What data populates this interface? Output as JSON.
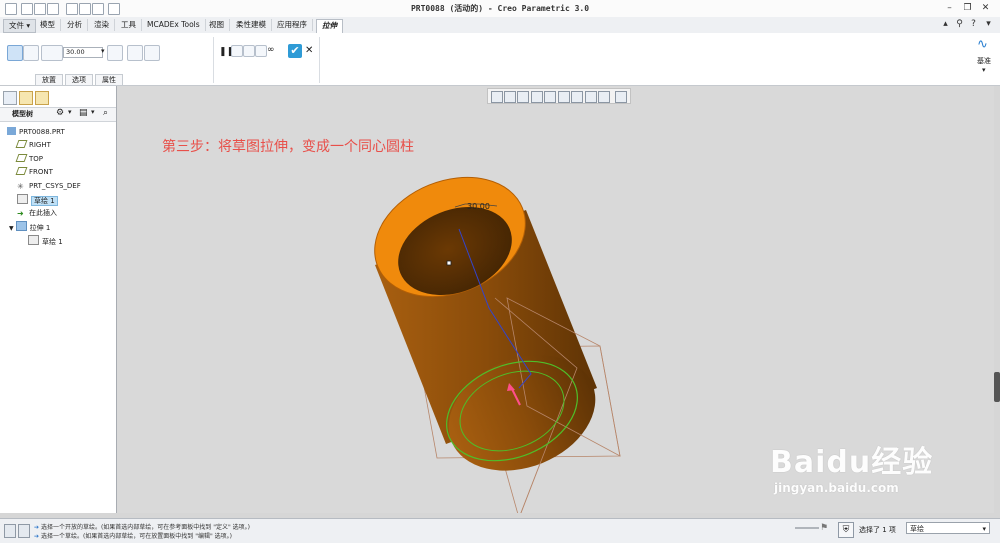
{
  "window": {
    "title": "PRT0088 (活动的) - Creo Parametric 3.0"
  },
  "menu_tabs": [
    {
      "label": "文件 ▾"
    },
    {
      "label": "模型"
    },
    {
      "label": "分析"
    },
    {
      "label": "渲染"
    },
    {
      "label": "工具"
    },
    {
      "label": "MCADEx Tools"
    },
    {
      "label": "视图"
    },
    {
      "label": "柔性建模"
    },
    {
      "label": "应用程序"
    },
    {
      "label": "拉伸"
    }
  ],
  "ribbon": {
    "depth_value": "30.00",
    "subtabs": [
      "放置",
      "选项",
      "属性"
    ],
    "datum_label": "基准"
  },
  "model_tree": {
    "header": "模型树",
    "items": [
      {
        "label": "PRT0088.PRT",
        "icon": "part-icon"
      },
      {
        "label": "RIGHT",
        "icon": "plane-icon"
      },
      {
        "label": "TOP",
        "icon": "plane-icon"
      },
      {
        "label": "FRONT",
        "icon": "plane-icon"
      },
      {
        "label": "PRT_CSYS_DEF",
        "icon": "csys-icon"
      },
      {
        "label": "草绘 1",
        "icon": "sketch-icon"
      },
      {
        "label": "在此插入",
        "icon": "insert-arrow-icon"
      },
      {
        "label": "拉伸 1",
        "icon": "extrude-icon"
      },
      {
        "label": "草绘 1",
        "icon": "sketch-icon"
      }
    ]
  },
  "annotation": "第三步：将草图拉伸，变成一个同心圆柱",
  "dimension_label": "30.00",
  "status": {
    "messages": [
      "选择一个开放的草绘。(如果首选内部草绘，可在参考面板中找到 \"定义\" 选项。)",
      "选择一个草绘。(如果首选内部草绘，可在放置面板中找到 \"编辑\" 选项。)"
    ],
    "selected_count": "选择了 1 项",
    "filter_value": "草绘"
  },
  "watermark": {
    "brand": "Baidu经验",
    "url": "jingyan.baidu.com"
  },
  "colors": {
    "cylinder_top": "#f08a0c",
    "cylinder_body": "#8a4c0a",
    "sketch_green": "#4fbe2a",
    "annotation": "#e8504a"
  }
}
